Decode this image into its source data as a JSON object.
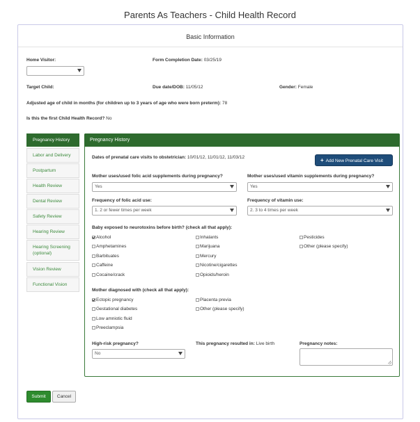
{
  "page_title": "Parents As Teachers - Child Health Record",
  "section_title": "Basic Information",
  "basic": {
    "home_visitor_label": "Home Visitor:",
    "home_visitor_value": "",
    "form_completion_label": "Form Completion Date:",
    "form_completion_value": "03/25/19",
    "target_child_label": "Target Child:",
    "target_child_value": "",
    "due_date_label": "Due date/DOB:",
    "due_date_value": "11/05/12",
    "gender_label": "Gender:",
    "gender_value": "Female",
    "adjusted_age_label": "Adjusted age of child in months (for children up to 3 years of age who were born preterm):",
    "adjusted_age_value": "78",
    "first_record_label": "Is this the first Child Health Record?",
    "first_record_value": "No"
  },
  "sidebar": {
    "items": [
      {
        "label": "Pregnancy History",
        "active": true
      },
      {
        "label": "Labor and Delivery",
        "active": false
      },
      {
        "label": "Postpartum",
        "active": false
      },
      {
        "label": "Health Review",
        "active": false
      },
      {
        "label": "Dental Review",
        "active": false
      },
      {
        "label": "Safety Review",
        "active": false
      },
      {
        "label": "Hearing Review",
        "active": false
      },
      {
        "label": "Hearing Screening (optional)",
        "active": false
      },
      {
        "label": "Vision Review",
        "active": false
      },
      {
        "label": "Functional Vision",
        "active": false
      }
    ]
  },
  "panel": {
    "header": "Pregnancy History",
    "prenatal_dates_label": "Dates of prenatal care visits to obstetrician:",
    "prenatal_dates_value": "10/01/12, 11/01/12, 11/03/12",
    "add_visit_button": "Add New Prenatal Care Visit",
    "folic_label": "Mother uses/used folic acid supplements during pregnancy?",
    "folic_value": "Yes",
    "vitamin_label": "Mother uses/used vitamin supplements during pregnancy?",
    "vitamin_value": "Yes",
    "folic_freq_label": "Frequency of folic acid use:",
    "folic_freq_value": "1. 2 or fewer times per week",
    "vitamin_freq_label": "Frequency of vitamin use:",
    "vitamin_freq_value": "2. 3 to 4 times per week",
    "neurotoxins_label": "Baby exposed to neurotoxins before birth? (check all that apply):",
    "neurotoxins": [
      {
        "label": "Alcohol",
        "checked": true
      },
      {
        "label": "Amphetamines",
        "checked": false
      },
      {
        "label": "Barbituates",
        "checked": false
      },
      {
        "label": "Caffeine",
        "checked": false
      },
      {
        "label": "Cocaine/crack",
        "checked": false
      },
      {
        "label": "Inhalants",
        "checked": false
      },
      {
        "label": "Marijuana",
        "checked": false
      },
      {
        "label": "Mercury",
        "checked": false
      },
      {
        "label": "Nicotine/cigarettes",
        "checked": false
      },
      {
        "label": "Opioids/heroin",
        "checked": false
      },
      {
        "label": "Pesticides",
        "checked": false
      },
      {
        "label": "Other (please specify)",
        "checked": false
      }
    ],
    "diagnosed_label": "Mother diagnosed with (check all that apply):",
    "diagnosed": [
      {
        "label": "Ectopic pregnancy",
        "checked": true
      },
      {
        "label": "Gestational diabetes",
        "checked": false
      },
      {
        "label": "Low amniotic fluid",
        "checked": false
      },
      {
        "label": "Preeclampsia",
        "checked": false
      },
      {
        "label": "Placenta previa",
        "checked": false
      },
      {
        "label": "Other (please specify)",
        "checked": false
      }
    ],
    "high_risk_label": "High-risk pregnancy?",
    "high_risk_value": "No",
    "resulted_label": "This pregnancy resulted in:",
    "resulted_value": "Live birth",
    "notes_label": "Pregnancy notes:",
    "notes_value": ""
  },
  "buttons": {
    "submit": "Submit",
    "cancel": "Cancel"
  },
  "colors": {
    "primary_green": "#2e6b2e",
    "accent_blue": "#1f4d7a",
    "submit_green": "#2e8b2e"
  }
}
